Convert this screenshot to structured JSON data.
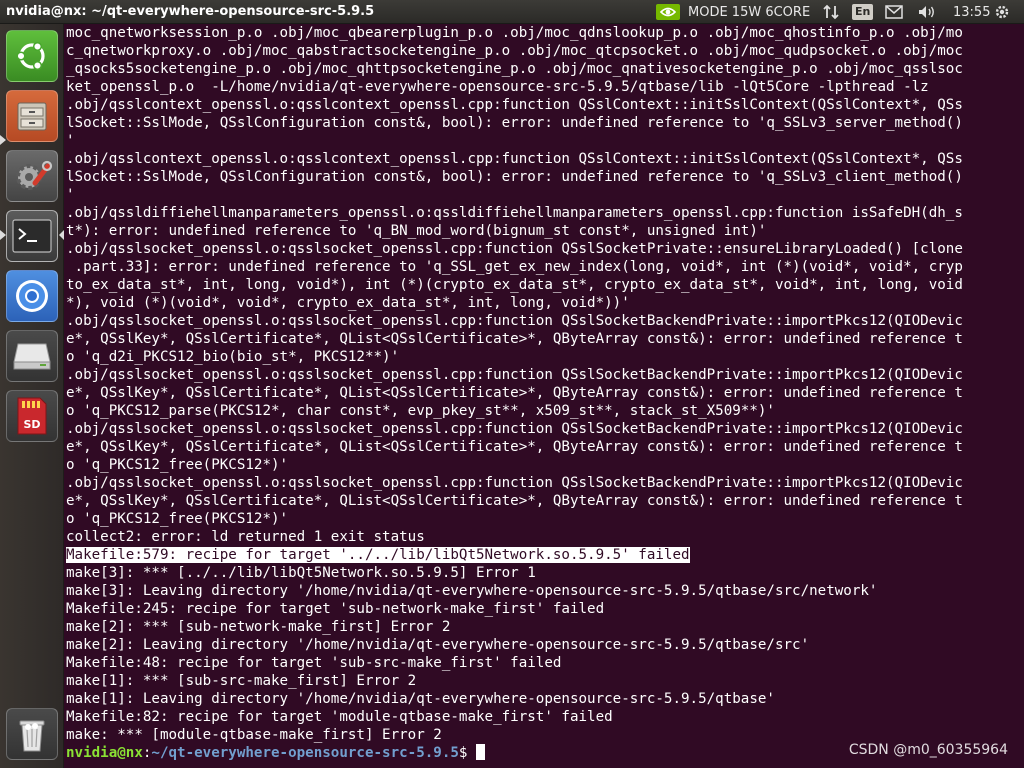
{
  "window": {
    "title": "nvidia@nx: ~/qt-everywhere-opensource-src-5.9.5"
  },
  "tray": {
    "power_mode": "MODE 15W 6CORE",
    "language": "En",
    "clock": "13:55"
  },
  "launcher": {
    "items": [
      {
        "name": "ubuntu-dash",
        "icon": "ubuntu-logo-icon"
      },
      {
        "name": "files",
        "icon": "file-cabinet-icon"
      },
      {
        "name": "system-settings",
        "icon": "settings-wrench-icon"
      },
      {
        "name": "terminal",
        "icon": "terminal-icon"
      },
      {
        "name": "chromium",
        "icon": "chromium-icon"
      },
      {
        "name": "drive",
        "icon": "drive-icon"
      },
      {
        "name": "sd-card",
        "icon": "sd-card-icon"
      },
      {
        "name": "trash",
        "icon": "trash-icon"
      }
    ],
    "sd_label": "SD"
  },
  "terminal": {
    "lines": [
      "moc_qnetworksession_p.o .obj/moc_qbearerplugin_p.o .obj/moc_qdnslookup_p.o .obj/moc_qhostinfo_p.o .obj/mo",
      "c_qnetworkproxy.o .obj/moc_qabstractsocketengine_p.o .obj/moc_qtcpsocket.o .obj/moc_qudpsocket.o .obj/moc",
      "_qsocks5socketengine_p.o .obj/moc_qhttpsocketengine_p.o .obj/moc_qnativesocketengine_p.o .obj/moc_qsslsoc",
      "ket_openssl_p.o  -L/home/nvidia/qt-everywhere-opensource-src-5.9.5/qtbase/lib -lQt5Core -lpthread -lz",
      ".obj/qsslcontext_openssl.o:qsslcontext_openssl.cpp:function QSslContext::initSslContext(QSslContext*, QSs",
      "lSocket::SslMode, QSslConfiguration const&, bool): error: undefined reference to 'q_SSLv3_server_method()",
      "'",
      ".obj/qsslcontext_openssl.o:qsslcontext_openssl.cpp:function QSslContext::initSslContext(QSslContext*, QSs",
      "lSocket::SslMode, QSslConfiguration const&, bool): error: undefined reference to 'q_SSLv3_client_method()",
      "'",
      ".obj/qssldiffiehellmanparameters_openssl.o:qssldiffiehellmanparameters_openssl.cpp:function isSafeDH(dh_s",
      "t*): error: undefined reference to 'q_BN_mod_word(bignum_st const*, unsigned int)'",
      ".obj/qsslsocket_openssl.o:qsslsocket_openssl.cpp:function QSslSocketPrivate::ensureLibraryLoaded() [clone",
      " .part.33]: error: undefined reference to 'q_SSL_get_ex_new_index(long, void*, int (*)(void*, void*, cryp",
      "to_ex_data_st*, int, long, void*), int (*)(crypto_ex_data_st*, crypto_ex_data_st*, void*, int, long, void",
      "*), void (*)(void*, void*, crypto_ex_data_st*, int, long, void*))'",
      ".obj/qsslsocket_openssl.o:qsslsocket_openssl.cpp:function QSslSocketBackendPrivate::importPkcs12(QIODevic",
      "e*, QSslKey*, QSslCertificate*, QList<QSslCertificate>*, QByteArray const&): error: undefined reference t",
      "o 'q_d2i_PKCS12_bio(bio_st*, PKCS12**)'",
      ".obj/qsslsocket_openssl.o:qsslsocket_openssl.cpp:function QSslSocketBackendPrivate::importPkcs12(QIODevic",
      "e*, QSslKey*, QSslCertificate*, QList<QSslCertificate>*, QByteArray const&): error: undefined reference t",
      "o 'q_PKCS12_parse(PKCS12*, char const*, evp_pkey_st**, x509_st**, stack_st_X509**)'",
      ".obj/qsslsocket_openssl.o:qsslsocket_openssl.cpp:function QSslSocketBackendPrivate::importPkcs12(QIODevic",
      "e*, QSslKey*, QSslCertificate*, QList<QSslCertificate>*, QByteArray const&): error: undefined reference t",
      "o 'q_PKCS12_free(PKCS12*)'",
      ".obj/qsslsocket_openssl.o:qsslsocket_openssl.cpp:function QSslSocketBackendPrivate::importPkcs12(QIODevic",
      "e*, QSslKey*, QSslCertificate*, QList<QSslCertificate>*, QByteArray const&): error: undefined reference t",
      "o 'q_PKCS12_free(PKCS12*)'",
      "collect2: error: ld returned 1 exit status"
    ],
    "highlighted_line": "Makefile:579: recipe for target '../../lib/libQt5Network.so.5.9.5' failed",
    "tail_lines": [
      "make[3]: *** [../../lib/libQt5Network.so.5.9.5] Error 1",
      "make[3]: Leaving directory '/home/nvidia/qt-everywhere-opensource-src-5.9.5/qtbase/src/network'",
      "Makefile:245: recipe for target 'sub-network-make_first' failed",
      "make[2]: *** [sub-network-make_first] Error 2",
      "make[2]: Leaving directory '/home/nvidia/qt-everywhere-opensource-src-5.9.5/qtbase/src'",
      "Makefile:48: recipe for target 'sub-src-make_first' failed",
      "make[1]: *** [sub-src-make_first] Error 2",
      "make[1]: Leaving directory '/home/nvidia/qt-everywhere-opensource-src-5.9.5/qtbase'",
      "Makefile:82: recipe for target 'module-qtbase-make_first' failed",
      "make: *** [module-qtbase-make_first] Error 2"
    ],
    "prompt": {
      "user_host": "nvidia@nx",
      "separator": ":",
      "path": "~/qt-everywhere-opensource-src-5.9.5",
      "symbol": "$ "
    }
  },
  "watermark": "CSDN @m0_60355964",
  "colors": {
    "terminal_bg": "#300a24",
    "prompt_user": "#8ae234",
    "prompt_path": "#729fcf"
  }
}
